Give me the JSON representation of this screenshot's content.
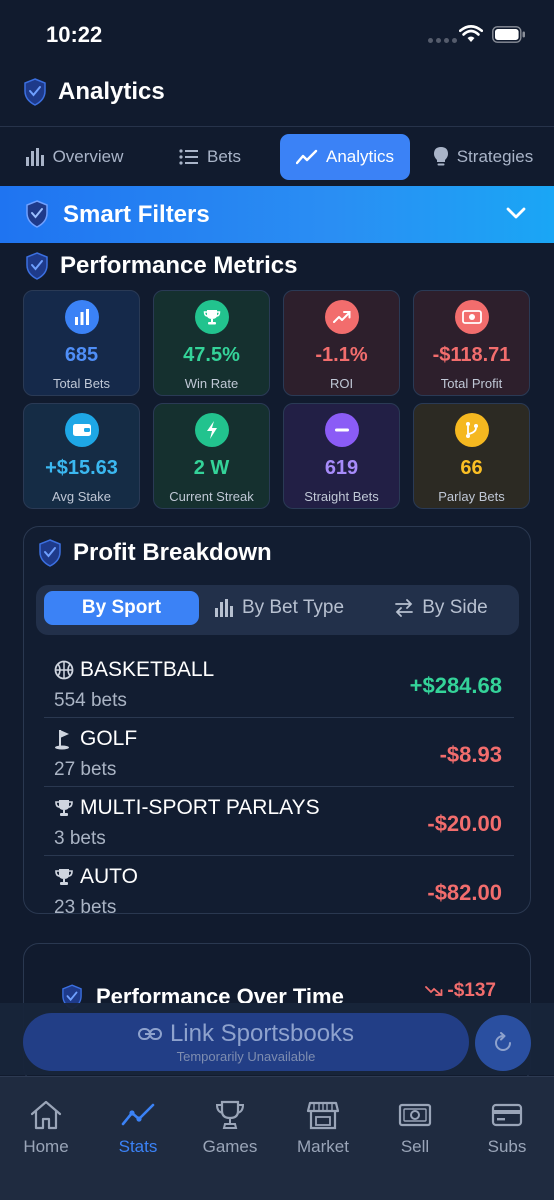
{
  "status_bar": {
    "time": "10:22"
  },
  "header": {
    "title": "Analytics"
  },
  "tabs": [
    {
      "label": "Overview",
      "icon": "bar-chart-icon",
      "active": false
    },
    {
      "label": "Bets",
      "icon": "list-icon",
      "active": false
    },
    {
      "label": "Analytics",
      "icon": "trend-line-icon",
      "active": true
    },
    {
      "label": "Strategies",
      "icon": "lightbulb-icon",
      "active": false
    }
  ],
  "smart_filters": {
    "label": "Smart Filters"
  },
  "performance": {
    "title": "Performance Metrics",
    "metrics": [
      {
        "value": "685",
        "label": "Total Bets",
        "icon": "bar-chart-icon",
        "icon_color": "#3b82f6",
        "value_color": "#4f8ef7"
      },
      {
        "value": "47.5%",
        "label": "Win Rate",
        "icon": "trophy-icon",
        "icon_color": "#22c38e",
        "value_color": "#34d399"
      },
      {
        "value": "-1.1%",
        "label": "ROI",
        "icon": "trend-up-icon",
        "icon_color": "#f26d6d",
        "value_color": "#f26d6d"
      },
      {
        "value": "-$118.71",
        "label": "Total Profit",
        "icon": "money-icon",
        "icon_color": "#f26d6d",
        "value_color": "#f26d6d"
      },
      {
        "value": "+$15.63",
        "label": "Avg Stake",
        "icon": "wallet-icon",
        "icon_color": "#1ea7e6",
        "value_color": "#3bb8f0"
      },
      {
        "value": "2 W",
        "label": "Current Streak",
        "icon": "bolt-icon",
        "icon_color": "#22c38e",
        "value_color": "#34d399"
      },
      {
        "value": "619",
        "label": "Straight Bets",
        "icon": "minus-icon",
        "icon_color": "#8b5cf6",
        "value_color": "#a78bfa"
      },
      {
        "value": "66",
        "label": "Parlay Bets",
        "icon": "branch-icon",
        "icon_color": "#f5b820",
        "value_color": "#fbbf24"
      }
    ]
  },
  "breakdown": {
    "title": "Profit Breakdown",
    "subtabs": [
      {
        "label": "By Sport",
        "active": true
      },
      {
        "label": "By Bet Type",
        "icon": "bar-chart-icon",
        "active": false
      },
      {
        "label": "By Side",
        "icon": "swap-icon",
        "active": false
      }
    ],
    "rows": [
      {
        "icon": "basketball-icon",
        "name": "BASKETBALL",
        "count": "554 bets",
        "amount": "+$284.68",
        "color": "#34d399"
      },
      {
        "icon": "golf-icon",
        "name": "GOLF",
        "count": "27 bets",
        "amount": "-$8.93",
        "color": "#f26d6d"
      },
      {
        "icon": "trophy-icon",
        "name": "MULTI-SPORT PARLAYS",
        "count": "3 bets",
        "amount": "-$20.00",
        "color": "#f26d6d"
      },
      {
        "icon": "trophy-icon",
        "name": "AUTO",
        "count": "23 bets",
        "amount": "-$82.00",
        "color": "#f26d6d"
      }
    ]
  },
  "perf_over_time": {
    "title": "Performance Over Time",
    "delta": "-$137"
  },
  "link_bar": {
    "label": "Link Sportsbooks",
    "sub": "Temporarily Unavailable"
  },
  "bottom_nav": [
    {
      "label": "Home",
      "icon": "home-icon",
      "active": false
    },
    {
      "label": "Stats",
      "icon": "stats-icon",
      "active": true
    },
    {
      "label": "Games",
      "icon": "trophy-icon",
      "active": false
    },
    {
      "label": "Market",
      "icon": "store-icon",
      "active": false
    },
    {
      "label": "Sell",
      "icon": "banknote-icon",
      "active": false
    },
    {
      "label": "Subs",
      "icon": "card-icon",
      "active": false
    }
  ],
  "colors": {
    "accent": "#3b82f6",
    "background": "#111b2e",
    "positive": "#34d399",
    "negative": "#f26d6d"
  }
}
